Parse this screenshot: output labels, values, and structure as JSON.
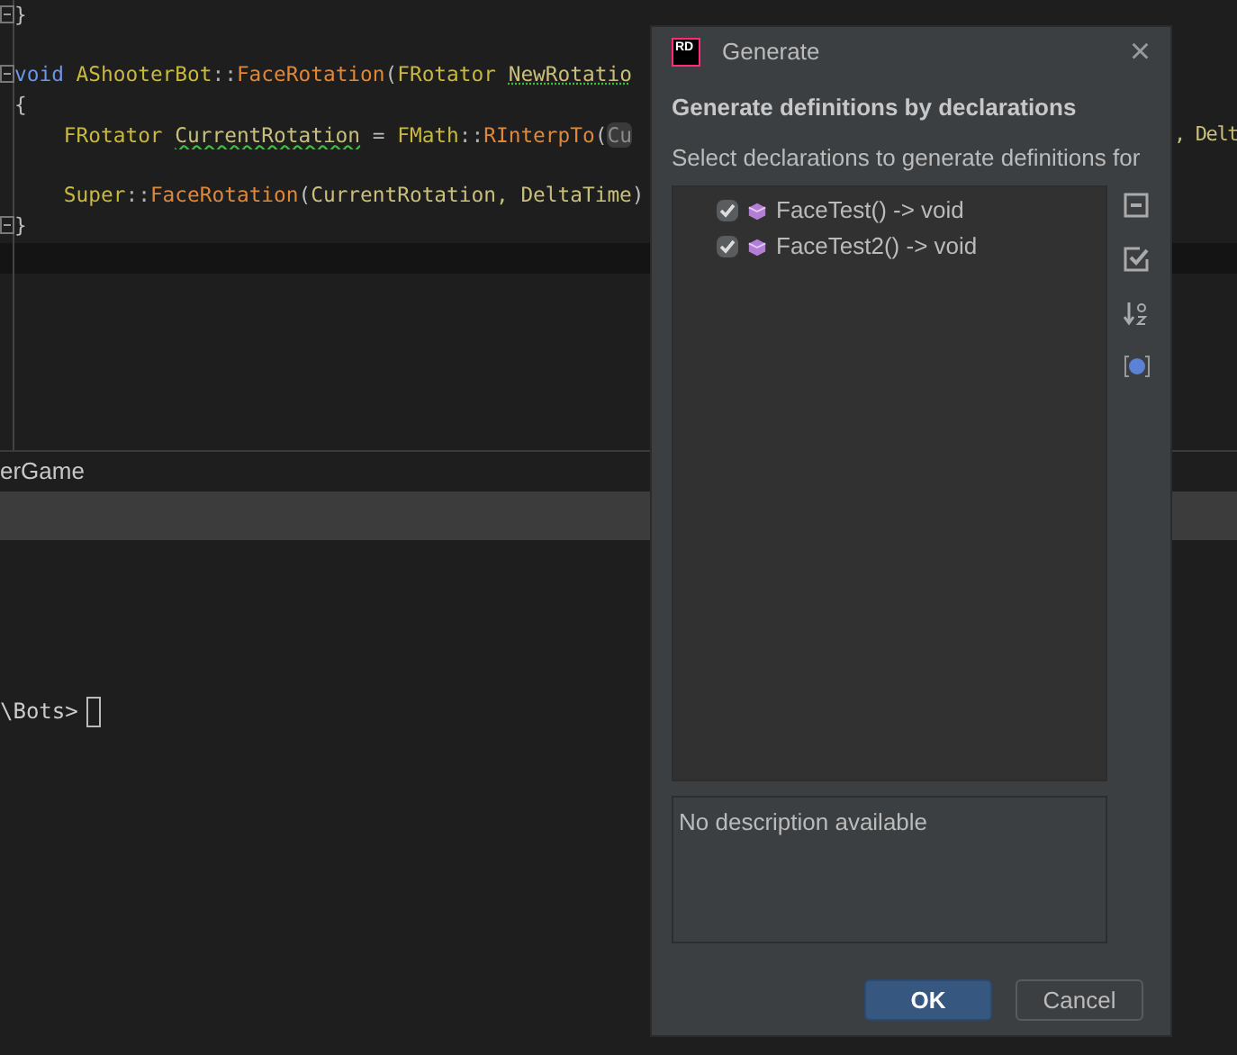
{
  "editor": {
    "lines": [
      {
        "folded": true,
        "tokens": [
          {
            "text": "}",
            "kind": "punct"
          }
        ]
      },
      {
        "folded": true,
        "gap_before": true,
        "tokens": [
          {
            "text": "void",
            "kind": "keyword"
          },
          {
            "text": " AShooterBot",
            "kind": "type"
          },
          {
            "text": "::",
            "kind": "op"
          },
          {
            "text": "FaceRotation",
            "kind": "function"
          },
          {
            "text": "(",
            "kind": "punct"
          },
          {
            "text": "FRotator ",
            "kind": "type"
          },
          {
            "text": "NewRotatio",
            "kind": "param",
            "suggestion": true
          }
        ]
      },
      {
        "folded": false,
        "tokens": [
          {
            "text": "{",
            "kind": "punct"
          }
        ]
      },
      {
        "folded": false,
        "tokens": [
          {
            "text": "    FRotator ",
            "kind": "type"
          },
          {
            "text": "CurrentRotation",
            "kind": "param",
            "warning": true
          },
          {
            "text": " = ",
            "kind": "punct"
          },
          {
            "text": "FMath",
            "kind": "type"
          },
          {
            "text": "::",
            "kind": "op"
          },
          {
            "text": "RInterpTo",
            "kind": "function"
          },
          {
            "text": "(",
            "kind": "punct"
          },
          {
            "text": "Cu",
            "kind": "hint"
          }
        ],
        "tail": ", Delt"
      },
      {
        "folded": false,
        "gap_before": true,
        "tokens": [
          {
            "text": "    Super",
            "kind": "type"
          },
          {
            "text": "::",
            "kind": "op"
          },
          {
            "text": "FaceRotation",
            "kind": "function"
          },
          {
            "text": "(",
            "kind": "punct"
          },
          {
            "text": "CurrentRotation, DeltaTime",
            "kind": "param"
          },
          {
            "text": ")",
            "kind": "punct"
          }
        ]
      },
      {
        "folded": true,
        "tokens": [
          {
            "text": "}",
            "kind": "punct"
          }
        ]
      }
    ]
  },
  "panel": {
    "title": "erGame",
    "prompt": "\\Bots>"
  },
  "dialog": {
    "logo": "RD",
    "title": "Generate",
    "close": "×",
    "heading": "Generate definitions by declarations",
    "subtitle": "Select declarations to generate definitions for",
    "items": [
      {
        "label": "FaceTest() -> void",
        "checked": true
      },
      {
        "label": "FaceTest2() -> void",
        "checked": true
      }
    ],
    "description": "No description available",
    "buttons": [
      {
        "label": "OK",
        "kind": "primary"
      },
      {
        "label": "Cancel",
        "kind": "secondary"
      }
    ]
  }
}
